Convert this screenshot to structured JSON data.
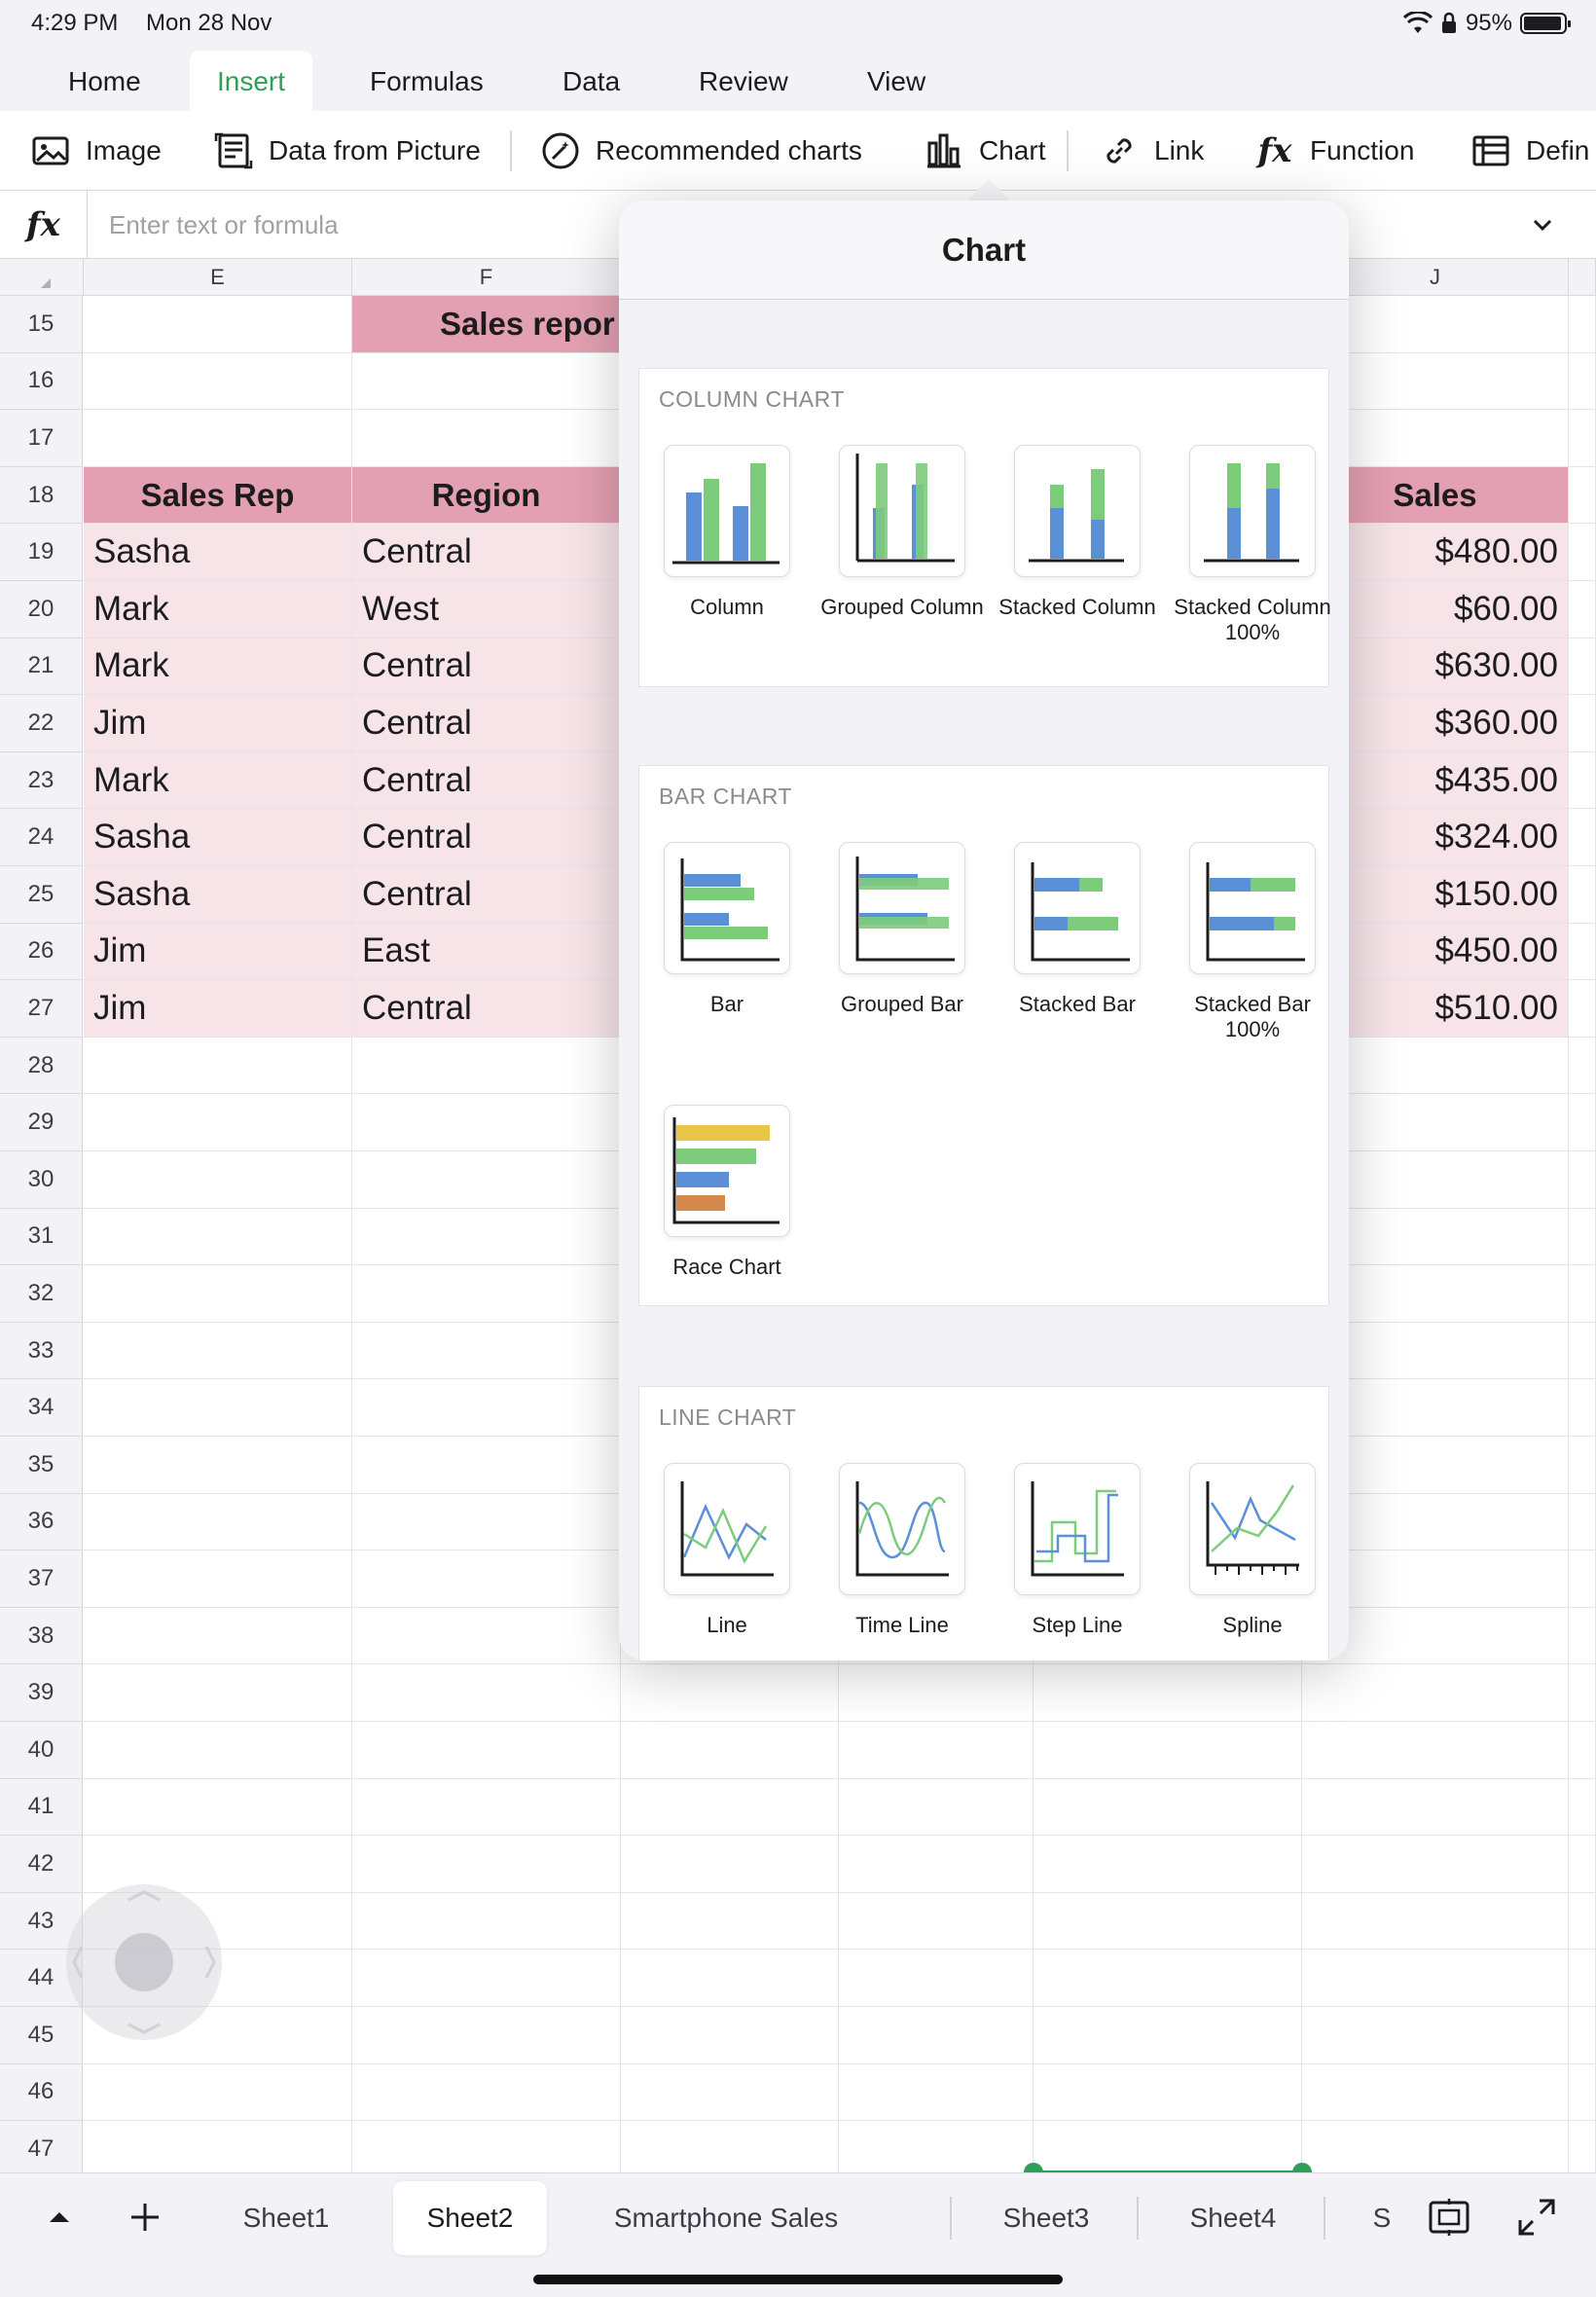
{
  "status_bar": {
    "time": "4:29 PM",
    "date": "Mon 28 Nov",
    "battery": "95%"
  },
  "ribbon_tabs": [
    "Home",
    "Insert",
    "Formulas",
    "Data",
    "Review",
    "View"
  ],
  "active_tab": "Insert",
  "toolbar": {
    "image": "Image",
    "data_from_picture": "Data from Picture",
    "recommended_charts": "Recommended charts",
    "chart": "Chart",
    "link": "Link",
    "function": "Function",
    "define": "Defin"
  },
  "formula_bar": {
    "fx": "fx",
    "placeholder": "Enter text or formula"
  },
  "sheet": {
    "col_headers": {
      "E": "E",
      "F": "F",
      "J": "J"
    },
    "row_numbers": [
      "15",
      "16",
      "17",
      "18",
      "19",
      "20",
      "21",
      "22",
      "23",
      "24",
      "25",
      "26",
      "27",
      "28",
      "29",
      "30",
      "31",
      "32",
      "33",
      "34",
      "35",
      "36",
      "37",
      "38",
      "39",
      "40",
      "41",
      "42",
      "43",
      "44",
      "45",
      "46",
      "47"
    ],
    "title": "Sales repor",
    "headers": {
      "sales_rep": "Sales Rep",
      "region": "Region",
      "sales": "Sales"
    },
    "rows": [
      {
        "rep": "Sasha",
        "region": "Central",
        "sales": "$480.00"
      },
      {
        "rep": "Mark",
        "region": "West",
        "sales": "$60.00"
      },
      {
        "rep": "Mark",
        "region": "Central",
        "sales": "$630.00"
      },
      {
        "rep": "Jim",
        "region": "Central",
        "sales": "$360.00"
      },
      {
        "rep": "Mark",
        "region": "Central",
        "sales": "$435.00"
      },
      {
        "rep": "Sasha",
        "region": "Central",
        "sales": "$324.00"
      },
      {
        "rep": "Sasha",
        "region": "Central",
        "sales": "$150.00"
      },
      {
        "rep": "Jim",
        "region": "East",
        "sales": "$450.00"
      },
      {
        "rep": "Jim",
        "region": "Central",
        "sales": "$510.00"
      }
    ]
  },
  "chart_popover": {
    "title": "Chart",
    "sections": [
      {
        "title": "COLUMN CHART",
        "options": [
          {
            "icon": "column-chart-icon",
            "label": "Column"
          },
          {
            "icon": "grouped-column-chart-icon",
            "label": "Grouped Column"
          },
          {
            "icon": "stacked-column-chart-icon",
            "label": "Stacked Column"
          },
          {
            "icon": "stacked-column-100-chart-icon",
            "label": "Stacked Column 100%"
          }
        ]
      },
      {
        "title": "BAR CHART",
        "options": [
          {
            "icon": "bar-chart-icon",
            "label": "Bar"
          },
          {
            "icon": "grouped-bar-chart-icon",
            "label": "Grouped Bar"
          },
          {
            "icon": "stacked-bar-chart-icon",
            "label": "Stacked Bar"
          },
          {
            "icon": "stacked-bar-100-chart-icon",
            "label": "Stacked Bar 100%"
          },
          {
            "icon": "race-chart-icon",
            "label": "Race Chart"
          }
        ]
      },
      {
        "title": "LINE CHART",
        "options": [
          {
            "icon": "line-chart-icon",
            "label": "Line"
          },
          {
            "icon": "time-line-chart-icon",
            "label": "Time Line"
          },
          {
            "icon": "step-line-chart-icon",
            "label": "Step Line"
          },
          {
            "icon": "spline-chart-icon",
            "label": "Spline"
          }
        ]
      }
    ]
  },
  "sheet_tabs": [
    "Sheet1",
    "Sheet2",
    "Smartphone Sales",
    "Sheet3",
    "Sheet4",
    "S"
  ],
  "active_sheet": "Sheet2",
  "colors": {
    "accent": "#2f9e57",
    "header_fill": "#e3a0b2",
    "data_fill": "#f6e4e8",
    "chart_blue": "#5b8fd6",
    "chart_green": "#7ccc7c",
    "chart_yellow": "#e8c547",
    "chart_orange": "#d4894a"
  }
}
